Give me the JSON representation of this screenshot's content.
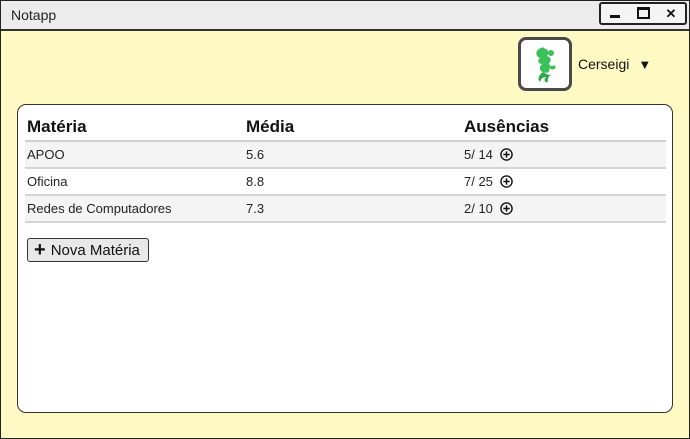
{
  "window": {
    "title": "Notapp"
  },
  "user": {
    "name": "Cerseigi",
    "caret": "▼"
  },
  "table": {
    "headers": [
      "Matéria",
      "Média",
      "Ausências"
    ],
    "rows": [
      {
        "materia": "APOO",
        "media": "5.6",
        "ausencias": "5/ 14"
      },
      {
        "materia": "Oficina",
        "media": "8.8",
        "ausencias": "7/ 25"
      },
      {
        "materia": "Redes de Computadores",
        "media": "7.3",
        "ausencias": "2/ 10"
      }
    ]
  },
  "actions": {
    "new_subject_label": "Nova Matéria"
  },
  "colors": {
    "background": "#fff9c4",
    "avatar_green": "#3cc05a"
  }
}
